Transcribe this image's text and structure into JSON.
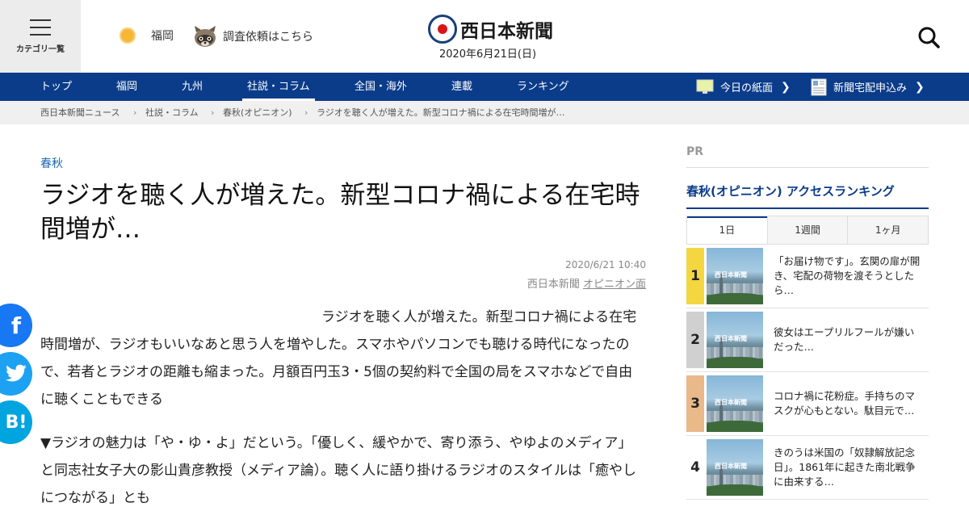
{
  "header": {
    "menu_label": "カテゴリ一覧",
    "weather_city": "福岡",
    "survey_label": "調査依頼はこちら",
    "logo_text": "西日本新聞",
    "date": "2020年6月21日(日)"
  },
  "nav": {
    "items": [
      {
        "label": "トップ"
      },
      {
        "label": "福岡"
      },
      {
        "label": "九州"
      },
      {
        "label": "社説・コラム"
      },
      {
        "label": "全国・海外"
      },
      {
        "label": "連載"
      },
      {
        "label": "ランキング"
      }
    ],
    "today_paper": "今日の紙面",
    "subscribe": "新聞宅配申込み"
  },
  "breadcrumb": [
    "西日本新聞ニュース",
    "社説・コラム",
    "春秋(オピニオン)",
    "ラジオを聴く人が増えた。新型コロナ禍による在宅時間増が…"
  ],
  "article": {
    "category": "春秋",
    "title": "ラジオを聴く人が増えた。新型コロナ禍による在宅時間増が…",
    "datetime": "2020/6/21 10:40",
    "source": "西日本新聞",
    "section_link": "オピニオン面",
    "paragraphs": [
      "ラジオを聴く人が増えた。新型コロナ禍による在宅時間増が、ラジオもいいなあと思う人を増やした。スマホやパソコンでも聴ける時代になったので、若者とラジオの距離も縮まった。月額百円玉3・5個の契約料で全国の局をスマホなどで自由に聴くこともできる",
      "▼ラジオの魅力は「や・ゆ・よ」だという。「優しく、緩やかで、寄り添う、やゆよのメディア」と同志社女子大の影山貴彦教授（メディア論）。聴く人に語り掛けるラジオのスタイルは「癒やしにつながる」とも"
    ]
  },
  "share": {
    "facebook": "f",
    "twitter": "t",
    "hatena": "B!"
  },
  "sidebar": {
    "pr_label": "PR",
    "ranking_title": "春秋(オピニオン) アクセスランキング",
    "tabs": [
      {
        "label": "1日"
      },
      {
        "label": "1週間"
      },
      {
        "label": "1ヶ月"
      }
    ],
    "thumb_watermark": "西日本新聞",
    "ranking": [
      {
        "rank": "1",
        "text": "「お届け物です」。玄関の扉が開き、宅配の荷物を渡そうとしたら…",
        "color": "#f4d641"
      },
      {
        "rank": "2",
        "text": "彼女はエープリルフールが嫌いだった…",
        "color": "#d0d0d0"
      },
      {
        "rank": "3",
        "text": "コロナ禍に花粉症。手持ちのマスクが心もとない。駄目元で…",
        "color": "#e9b98a"
      },
      {
        "rank": "4",
        "text": "きのうは米国の「奴隷解放記念日」。1861年に起きた南北戦争に由来する…",
        "color": "#ffffff"
      }
    ]
  },
  "colors": {
    "nav_bg": "#0b3c8a",
    "logo_red": "#d7141a",
    "category_blue": "#1a66b0"
  }
}
